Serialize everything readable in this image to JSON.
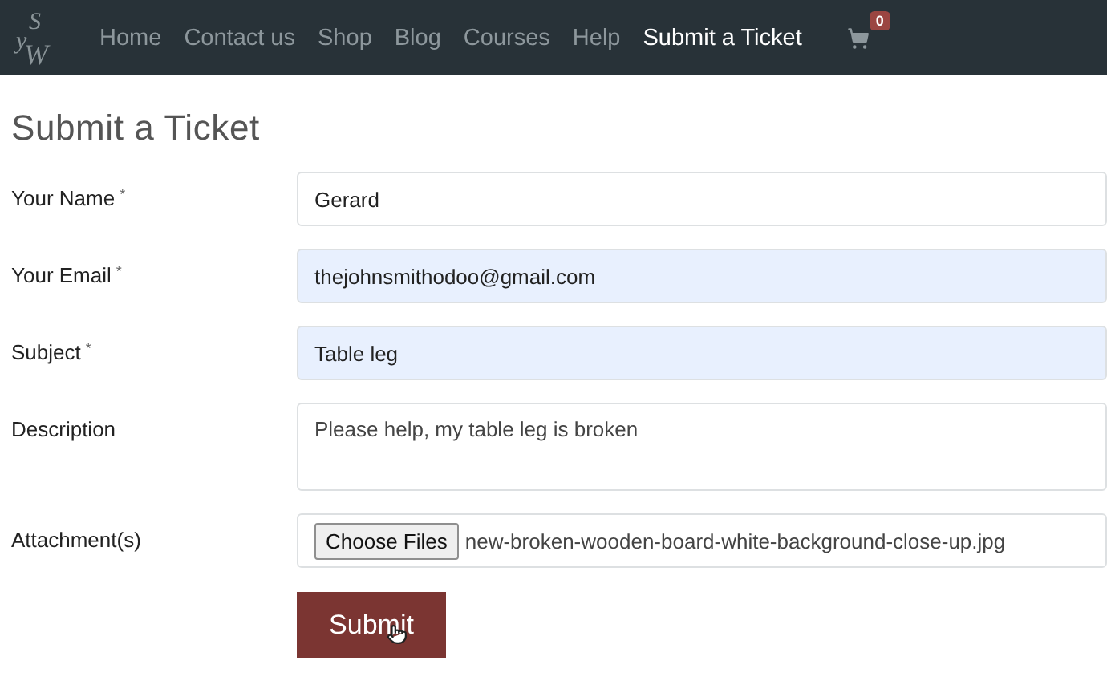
{
  "nav": {
    "logo": [
      "S",
      "y",
      "W"
    ],
    "items": [
      {
        "label": "Home",
        "selected": false
      },
      {
        "label": "Contact us",
        "selected": false
      },
      {
        "label": "Shop",
        "selected": false
      },
      {
        "label": "Blog",
        "selected": false
      },
      {
        "label": "Courses",
        "selected": false
      },
      {
        "label": "Help",
        "selected": false
      },
      {
        "label": "Submit a Ticket",
        "selected": true
      }
    ],
    "cart_count": "0"
  },
  "title": "Submit a Ticket",
  "fields": [
    {
      "kind": "text",
      "label": "Your Name",
      "required_mark": "*",
      "value": "Gerard",
      "autofilled": false
    },
    {
      "kind": "text",
      "label": "Your Email",
      "required_mark": "*",
      "value": "thejohnsmithodoo@gmail.com",
      "autofilled": true
    },
    {
      "kind": "text",
      "label": "Subject",
      "required_mark": "*",
      "value": "Table leg",
      "autofilled": true
    },
    {
      "kind": "textarea",
      "label": "Description",
      "value": "Please help, my table leg is broken",
      "autofilled": false
    },
    {
      "kind": "file",
      "label": "Attachment(s)",
      "button": "Choose Files",
      "value": "new-broken-wooden-board-white-background-close-up.jpg"
    }
  ],
  "submit": "Submit"
}
